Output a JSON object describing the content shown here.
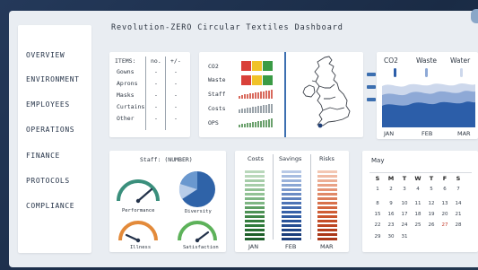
{
  "dashboard": {
    "title": "Revolution-ZERO Circular Textiles Dashboard"
  },
  "sidebar": {
    "items": [
      {
        "label": "OVERVIEW"
      },
      {
        "label": "ENVIRONMENT"
      },
      {
        "label": "EMPLOYEES"
      },
      {
        "label": "OPERATIONS"
      },
      {
        "label": "FINANCE"
      },
      {
        "label": "PROTOCOLS"
      },
      {
        "label": "COMPLIANCE"
      }
    ]
  },
  "items_table": {
    "headers": [
      "ITEMS:",
      "no.",
      "+/-"
    ],
    "rows": [
      {
        "name": "Gowns",
        "no": "-",
        "delta": "-"
      },
      {
        "name": "Aprons",
        "no": "-",
        "delta": "-"
      },
      {
        "name": "Masks",
        "no": "-",
        "delta": "-"
      },
      {
        "name": "Curtains",
        "no": "-",
        "delta": "-"
      },
      {
        "name": "Other",
        "no": "-",
        "delta": "-"
      }
    ]
  },
  "metrics": {
    "labels": [
      "CO2",
      "Waste",
      "Staff",
      "Costs",
      "OPS"
    ],
    "status_colors": [
      "#d9413a",
      "#f0c229",
      "#3a9b45"
    ]
  },
  "environment_chart": {
    "legend": [
      "CO2",
      "Waste",
      "Water"
    ],
    "months": [
      "JAN",
      "FEB",
      "MAR"
    ],
    "colors": {
      "dark": "#2c5ea9",
      "mid": "#8ea9d6",
      "light": "#cdd8ec"
    }
  },
  "staff_panel": {
    "title": "Staff: (NUMBER)",
    "gauges": [
      {
        "label": "Performance",
        "level": 0.7,
        "color": "#3a8f7c"
      },
      {
        "label": "Illness",
        "level": 0.15,
        "color": "#e38a3a"
      },
      {
        "label": "Satisfaction",
        "level": 0.65,
        "color": "#5db25a"
      }
    ],
    "pie_label": "Diversity",
    "pie_colors": [
      "#2f63a8",
      "#6a98cf",
      "#b8cde9"
    ]
  },
  "cost_panel": {
    "headers": [
      "Costs",
      "Savings",
      "Risks"
    ],
    "months": [
      "JAN",
      "FEB",
      "MAR"
    ],
    "colors": [
      "#2f7a3b",
      "#2c5ea9",
      "#d2552d"
    ]
  },
  "calendar": {
    "month": "May",
    "weekdays": [
      "S",
      "M",
      "T",
      "W",
      "T",
      "F",
      "S"
    ],
    "days": [
      [
        "1",
        "2",
        "3",
        "4",
        "5",
        "6",
        "7"
      ],
      [
        "8",
        "9",
        "10",
        "11",
        "12",
        "13",
        "14"
      ],
      [
        "15",
        "16",
        "17",
        "18",
        "19",
        "20",
        "21"
      ],
      [
        "22",
        "23",
        "24",
        "25",
        "26",
        "27",
        "28"
      ],
      [
        "29",
        "30",
        "31",
        "",
        "",
        "",
        ""
      ]
    ],
    "highlight_day": "27"
  }
}
